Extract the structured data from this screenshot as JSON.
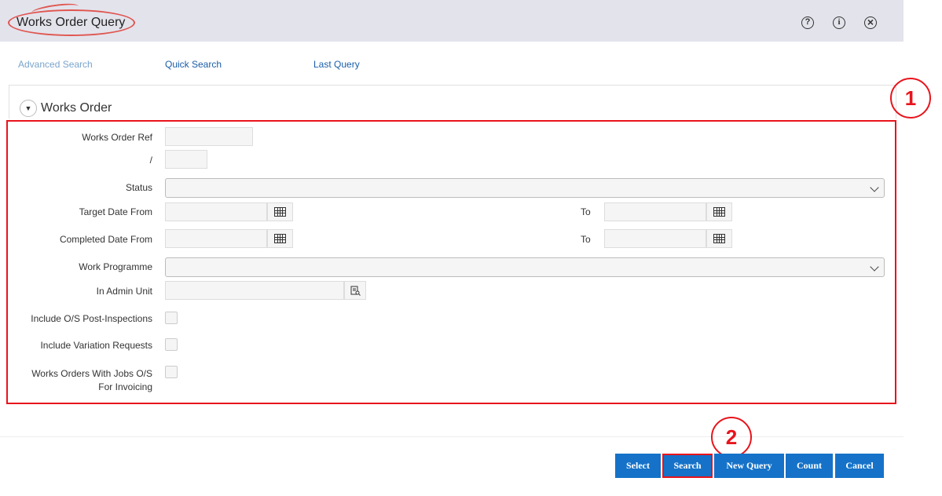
{
  "header": {
    "title": "Works Order Query",
    "icons": [
      "help-icon",
      "info-icon",
      "close-icon"
    ],
    "help_glyph": "?",
    "info_glyph": "i",
    "close_glyph": "×"
  },
  "tabs": [
    {
      "label": "Advanced Search"
    },
    {
      "label": "Quick Search"
    },
    {
      "label": "Last Query"
    }
  ],
  "section": {
    "title": "Works Order",
    "toggle_glyph": "▼"
  },
  "form": {
    "works_order_ref_label": "Works Order Ref",
    "slash_label": "/",
    "status_label": "Status",
    "target_date_from_label": "Target Date From",
    "target_to_label": "To",
    "completed_date_from_label": "Completed Date From",
    "completed_to_label": "To",
    "work_programme_label": "Work Programme",
    "admin_unit_label": "In Admin Unit",
    "include_os_post_label": "Include O/S Post-Inspections",
    "include_variation_label": "Include Variation Requests",
    "works_orders_jobs_label_line1": "Works Orders With Jobs O/S",
    "works_orders_jobs_label_line2": "For Invoicing",
    "works_order_ref_value": "",
    "slash_value": "",
    "status_value": "",
    "target_date_from_value": "",
    "target_to_value": "",
    "completed_date_from_value": "",
    "completed_to_value": "",
    "work_programme_value": "",
    "admin_unit_value": ""
  },
  "buttons": {
    "select": "Select",
    "search": "Search",
    "new_query": "New Query",
    "count": "Count",
    "cancel": "Cancel"
  },
  "annotations": {
    "one": "1",
    "two": "2"
  },
  "colors": {
    "accent": "#1572c8",
    "annotation_red": "#e8141c",
    "header_bg": "#e3e3ec"
  }
}
